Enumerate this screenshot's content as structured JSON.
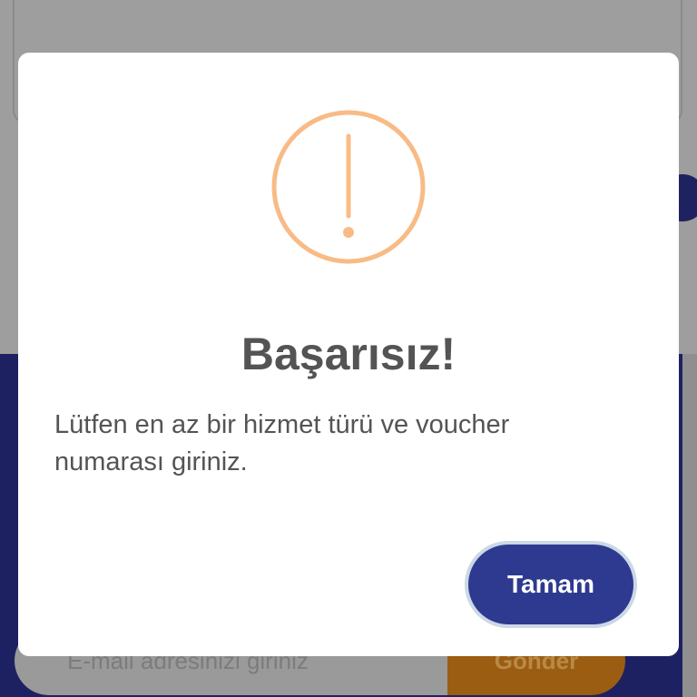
{
  "background": {
    "email_placeholder": "E-mail adresinizi giriniz",
    "send_label": "Gönder"
  },
  "dialog": {
    "icon": "exclamation-circle-icon",
    "title": "Başarısız!",
    "message": "Lütfen en az bir hizmet türü ve voucher numarası giriniz.",
    "confirm_label": "Tamam"
  },
  "colors": {
    "icon_accent": "#f8bb86",
    "button": "#2e3990",
    "footer": "#1e2161",
    "send": "#9a5d12"
  }
}
